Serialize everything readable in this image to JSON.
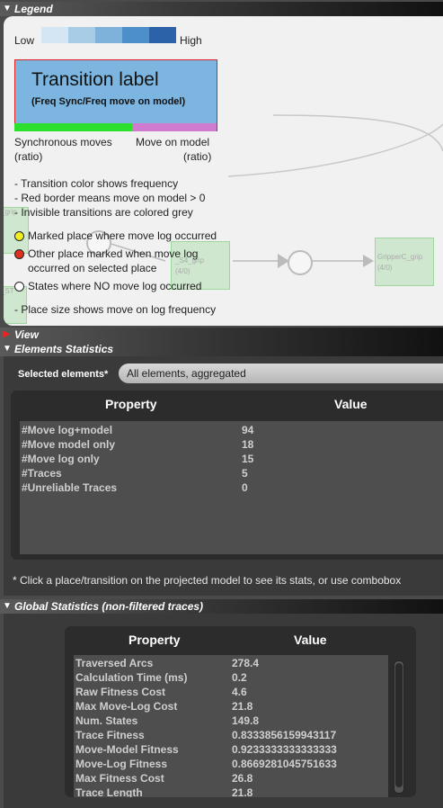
{
  "legend": {
    "header": "Legend",
    "low_label": "Low",
    "high_label": "High",
    "scale_colors": [
      "#d4e5f4",
      "#a9cce6",
      "#7fb2da",
      "#4d8fc8",
      "#2b62a8"
    ],
    "transition_label": "Transition label",
    "transition_sub": "(Freq Sync/Freq move on model)",
    "sync_label": "Synchronous moves",
    "sync_ratio": "(ratio)",
    "model_label": "Move on model",
    "model_ratio": "(ratio)",
    "note1": "- Transition color shows frequency",
    "note2": "- Red border means move on model > 0",
    "note3": "- Invisible transitions are colored grey",
    "marked_place": "Marked place where move log occurred",
    "other_place_1": "Other place marked when move log",
    "other_place_2": "occurred on selected place",
    "states_none": "States where NO move log occurred",
    "place_size": "- Place size shows move on log frequency",
    "bg_model_labels": [
      "_grip",
      "(4/0)",
      "_S4_grip",
      "(4/0)",
      "GripperC_grip",
      "(4/0)",
      "_ST"
    ],
    "colors": {
      "yellow_dot": "#f0f020",
      "red_dot": "#e03020",
      "white_dot": "#ffffff",
      "red_border": "#dd2222",
      "sync_bar": "#2ee02e",
      "model_bar": "#d07ad0"
    }
  },
  "view": {
    "header": "View"
  },
  "elements": {
    "header": "Elements Statistics",
    "selected_label": "Selected elements*",
    "selected_value": "All elements, aggregated",
    "col_property": "Property",
    "col_value": "Value",
    "rows": [
      {
        "property": "#Move log+model",
        "value": "94"
      },
      {
        "property": "#Move model only",
        "value": "18"
      },
      {
        "property": "#Move log only",
        "value": "15"
      },
      {
        "property": "#Traces",
        "value": "5"
      },
      {
        "property": "#Unreliable Traces",
        "value": "0"
      }
    ],
    "note": "* Click a place/transition on the projected model to see its stats, or use combobox"
  },
  "global": {
    "header": "Global Statistics (non-filtered traces)",
    "col_property": "Property",
    "col_value": "Value",
    "rows": [
      {
        "property": "Traversed Arcs",
        "value": "278.4"
      },
      {
        "property": "Calculation Time (ms)",
        "value": "0.2"
      },
      {
        "property": "Raw Fitness Cost",
        "value": "4.6"
      },
      {
        "property": "Max Move-Log Cost",
        "value": "21.8"
      },
      {
        "property": "Num. States",
        "value": "149.8"
      },
      {
        "property": "Trace Fitness",
        "value": "0.8333856159943117"
      },
      {
        "property": "Move-Model Fitness",
        "value": "0.9233333333333333"
      },
      {
        "property": "Move-Log Fitness",
        "value": "0.8669281045751633"
      },
      {
        "property": "Max Fitness Cost",
        "value": "26.8"
      },
      {
        "property": "Trace Length",
        "value": "21.8"
      }
    ]
  }
}
